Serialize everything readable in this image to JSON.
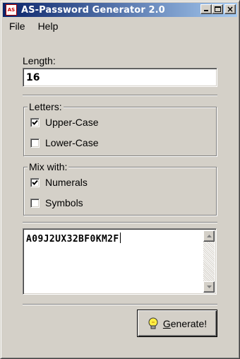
{
  "window": {
    "title": "AS-Password Generator 2.0",
    "icon_text": "AS"
  },
  "titlebar_buttons": {
    "minimize": "minimize",
    "maximize": "maximize",
    "close": "close"
  },
  "menu": {
    "items": [
      "File",
      "Help"
    ]
  },
  "length": {
    "label": "Length:",
    "value": "16"
  },
  "letters": {
    "legend": "Letters:",
    "options": [
      {
        "label": "Upper-Case",
        "checked": true
      },
      {
        "label": "Lower-Case",
        "checked": false
      }
    ]
  },
  "mix": {
    "legend": "Mix with:",
    "options": [
      {
        "label": "Numerals",
        "checked": true
      },
      {
        "label": "Symbols",
        "checked": false
      }
    ]
  },
  "output": {
    "password": "A09J2UX32BF0KM2F"
  },
  "generate": {
    "mnemonic": "G",
    "rest": "enerate!",
    "icon": "lightbulb-icon"
  }
}
